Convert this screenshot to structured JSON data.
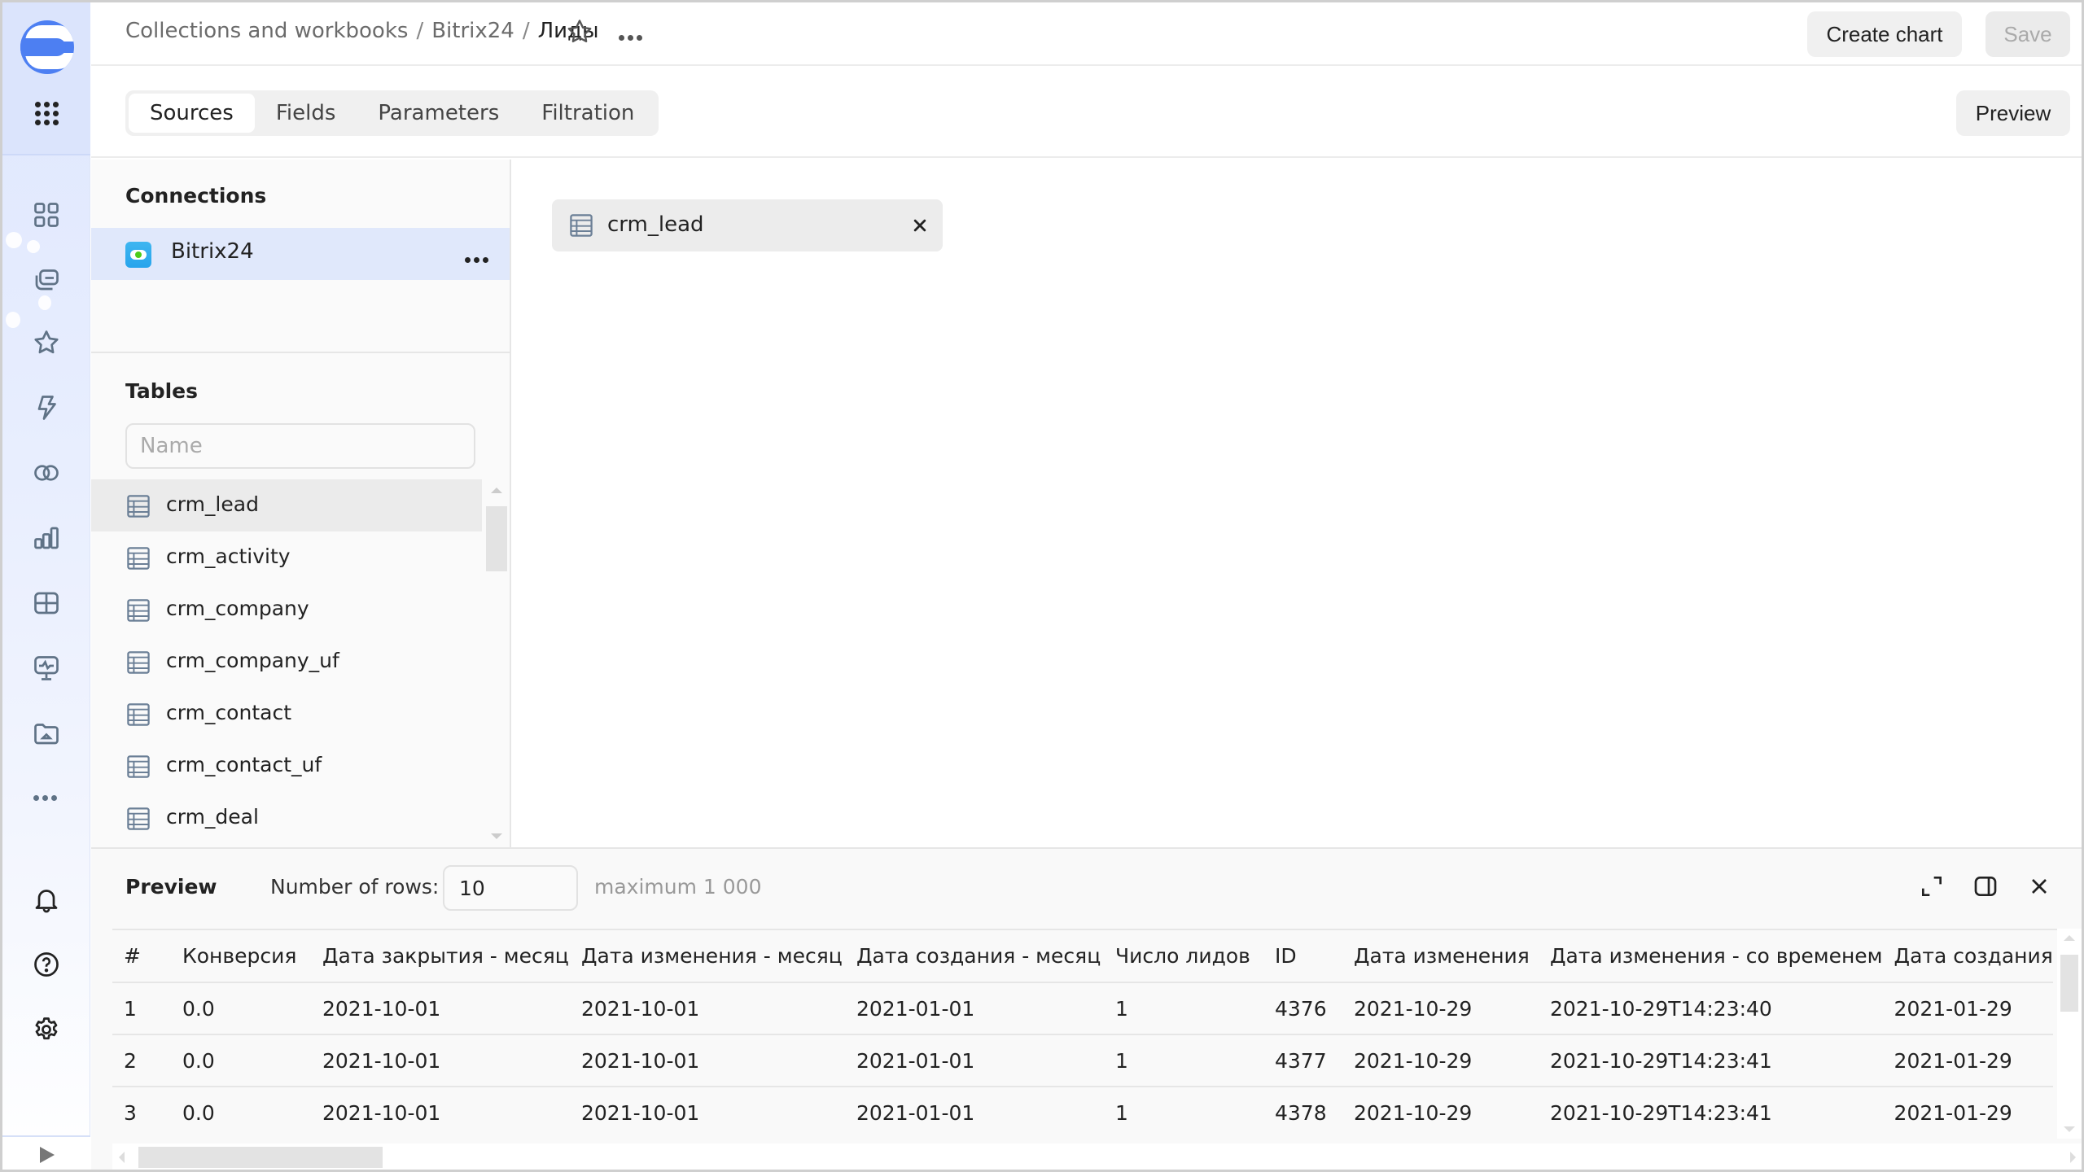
{
  "header": {
    "breadcrumb": [
      "Collections and workbooks",
      "Bitrix24",
      "Лиды"
    ],
    "separator": "/",
    "create_chart_label": "Create chart",
    "save_label": "Save"
  },
  "tabs": [
    {
      "label": "Sources",
      "active": true
    },
    {
      "label": "Fields",
      "active": false
    },
    {
      "label": "Parameters",
      "active": false
    },
    {
      "label": "Filtration",
      "active": false
    }
  ],
  "preview_button_label": "Preview",
  "left_panel": {
    "connections_title": "Connections",
    "connection": {
      "name": "Bitrix24",
      "icon": "bitrix24-cloud-icon"
    },
    "tables_title": "Tables",
    "search_placeholder": "Name",
    "search_value": "",
    "tables": [
      "crm_lead",
      "crm_activity",
      "crm_company",
      "crm_company_uf",
      "crm_contact",
      "crm_contact_uf",
      "crm_deal"
    ],
    "selected_table": "crm_lead"
  },
  "workspace": {
    "source_chip": "crm_lead"
  },
  "sidebar": {
    "items": [
      "dashboard-grid-icon",
      "collections-icon",
      "favorites-star-icon",
      "connections-bolt-icon",
      "datasets-icon",
      "charts-icon",
      "dashboards-icon",
      "monitoring-icon",
      "folder-home-icon",
      "more-icon"
    ],
    "bottom": [
      "notifications-bell-icon",
      "help-icon",
      "settings-gear-icon"
    ]
  },
  "preview": {
    "title": "Preview",
    "rows_label": "Number of rows:",
    "rows_value": "10",
    "max_hint": "maximum 1 000",
    "columns": [
      "#",
      "Конверсия",
      "Дата закрытия - месяц",
      "Дата изменения - месяц",
      "Дата создания - месяц",
      "Число лидов",
      "ID",
      "Дата изменения",
      "Дата изменения - со временем",
      "Дата создания"
    ],
    "rows": [
      [
        "1",
        "0.0",
        "2021-10-01",
        "2021-10-01",
        "2021-01-01",
        "1",
        "4376",
        "2021-10-29",
        "2021-10-29T14:23:40",
        "2021-01-29"
      ],
      [
        "2",
        "0.0",
        "2021-10-01",
        "2021-10-01",
        "2021-01-01",
        "1",
        "4377",
        "2021-10-29",
        "2021-10-29T14:23:41",
        "2021-01-29"
      ],
      [
        "3",
        "0.0",
        "2021-10-01",
        "2021-10-01",
        "2021-01-01",
        "1",
        "4378",
        "2021-10-29",
        "2021-10-29T14:23:41",
        "2021-01-29"
      ]
    ]
  },
  "colors": {
    "accent": "#4d7ff2",
    "sidebar_bg": "#dfe7fd",
    "selected_connection_bg": "#e0e8fb",
    "button_bg": "#f0f0f0"
  }
}
